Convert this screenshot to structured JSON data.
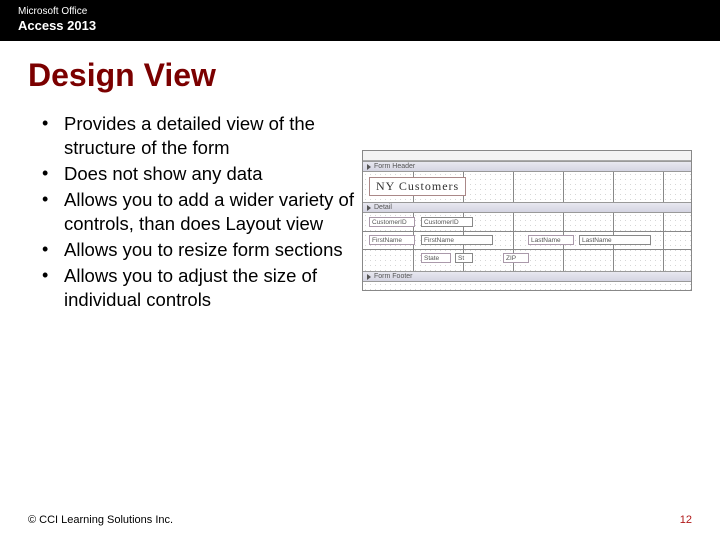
{
  "header": {
    "line1": "Microsoft Office",
    "line2": "Access 2013"
  },
  "title": "Design View",
  "bullets": [
    "Provides a detailed view of the structure of the form",
    "Does not show any data",
    "Allows you to add a wider variety of controls, than does Layout view",
    "Allows you to resize form sections",
    "Allows you to adjust the size of individual controls"
  ],
  "design": {
    "sections": {
      "formHeader": "Form Header",
      "detail": "Detail",
      "formFooter": "Form Footer"
    },
    "formTitle": "NY Customers",
    "row1": {
      "label1": "CustomerID",
      "field1": "CustomerID"
    },
    "row2": {
      "label1": "FirstName",
      "field1": "FirstName",
      "label2": "LastName",
      "field2": "LastName"
    },
    "row3": {
      "label1": "State",
      "field1": "St",
      "label2": "ZIP"
    }
  },
  "footer": {
    "copyright": "© CCI Learning Solutions Inc.",
    "page": "12"
  }
}
